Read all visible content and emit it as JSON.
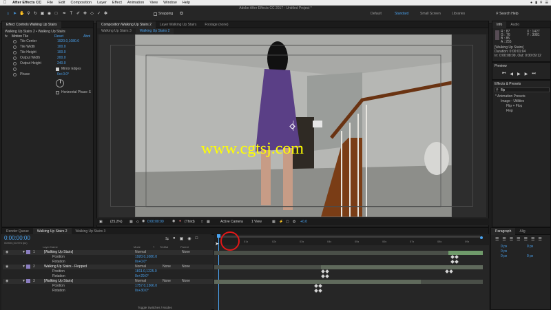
{
  "menubar": {
    "apple": "",
    "app": "After Effects CC",
    "items": [
      "File",
      "Edit",
      "Composition",
      "Layer",
      "Effect",
      "Animation",
      "View",
      "Window",
      "Help"
    ]
  },
  "window_title": "Adobe After Effects CC 2017 - Untitled Project *",
  "toolbar": {
    "snapping_label": "Snapping",
    "workspaces": [
      "Default",
      "Standard",
      "Small Screen",
      "Libraries"
    ],
    "active_workspace": "Standard",
    "search_help": "Search Help"
  },
  "effect_controls": {
    "tab_label": "Effect Controls Walking Up Stairs",
    "breadcrumb": "Walking Up Stairs 2 • Walking Up Stairs",
    "effect_name": "Motion Tile",
    "reset": "Reset",
    "about": "Abot",
    "params": [
      {
        "label": "Tile Center",
        "value": "1920.0,1080.0"
      },
      {
        "label": "Tile Width",
        "value": "100.0"
      },
      {
        "label": "Tile Height",
        "value": "100.0"
      },
      {
        "label": "Output Width",
        "value": "200.0"
      },
      {
        "label": "Output Height",
        "value": "240.0"
      },
      {
        "label": "Mirror Edges",
        "value": "Mirror Edges"
      },
      {
        "label": "Phase",
        "value": "0x+0.0°"
      },
      {
        "label": "",
        "value": "Horizontal Phase S"
      }
    ]
  },
  "composition": {
    "tabs": [
      "Composition Walking Up Stairs 2",
      "Layer Walking Up Stairs",
      "Footage (none)"
    ],
    "subtabs": [
      "Walking Up Stairs 3",
      "Walking Up Stairs 2"
    ],
    "watermark": "www.cgtsj.com",
    "viewer_bar": {
      "zoom": "(25.2%)",
      "timecode": "0:00:00:00",
      "resolution": "(Third)",
      "camera": "Active Camera",
      "views": "1 View",
      "exposure": "+0.0"
    }
  },
  "info": {
    "tabs": [
      "Info",
      "Audio"
    ],
    "r": "R : 87",
    "g": "G : 76",
    "b": "B : 85",
    "a": "A : 255",
    "x": "X : 1427",
    "y": "Y : 3081",
    "layer": "[Walking Up Stairs]",
    "duration": "Duration: 0:00:01:04",
    "in_out": "In: 0:00:08:09, Out: 0:00:09:12"
  },
  "preview": {
    "label": "Preview"
  },
  "effects_presets": {
    "label": "Effects & Presets",
    "search_value": "flip",
    "tree": [
      "* Animation Presets",
      "Image - Utilities",
      "Flip + Flop",
      "Flop"
    ]
  },
  "timeline": {
    "tabs": [
      "Render Queue",
      "Walking Up Stairs 2",
      "Walking Up Stairs 3"
    ],
    "timecode": "0:00:00:00",
    "fps": "00000 (23.976 fps)",
    "columns": [
      "Layer Name",
      "Mode",
      "T",
      "TrkMat",
      "Parent"
    ],
    "ruler": [
      "01s",
      "02s",
      "03s",
      "04s",
      "05s",
      "06s",
      "07s",
      "08s",
      "09s"
    ],
    "layers": [
      {
        "num": "1",
        "name": "[Walking Up Stairs]",
        "mode": "Normal",
        "trkmat": "",
        "parent": "None",
        "props": [
          {
            "name": "Position",
            "value": "1920.0,1080.0"
          },
          {
            "name": "Rotation",
            "value": "0x+0.0°"
          }
        ]
      },
      {
        "num": "2",
        "name": "Walking Up Stairs - Flopped",
        "mode": "Normal",
        "trkmat": "None",
        "parent": "None",
        "props": [
          {
            "name": "Position",
            "value": "1811.0,1225.0"
          },
          {
            "name": "Rotation",
            "value": "0x+29.0°"
          }
        ]
      },
      {
        "num": "3",
        "name": "[Walking Up Stairs]",
        "mode": "Normal",
        "trkmat": "None",
        "parent": "None",
        "props": [
          {
            "name": "Position",
            "value": "1757.0,1366.0"
          },
          {
            "name": "Rotation",
            "value": "0x+30.0°"
          }
        ]
      }
    ],
    "toggle_label": "Toggle Switches / Modes"
  },
  "paragraph": {
    "tabs": [
      "Paragraph",
      "Alig"
    ],
    "fields": [
      "0 px",
      "0 px",
      "0 px",
      "0 px",
      "0 px"
    ]
  },
  "colors": {
    "accent": "#4aa3f0",
    "track_light": "#606a5c",
    "track_dark": "#4a4f48",
    "watermark": "#ffff00",
    "annotation": "#e01818"
  }
}
